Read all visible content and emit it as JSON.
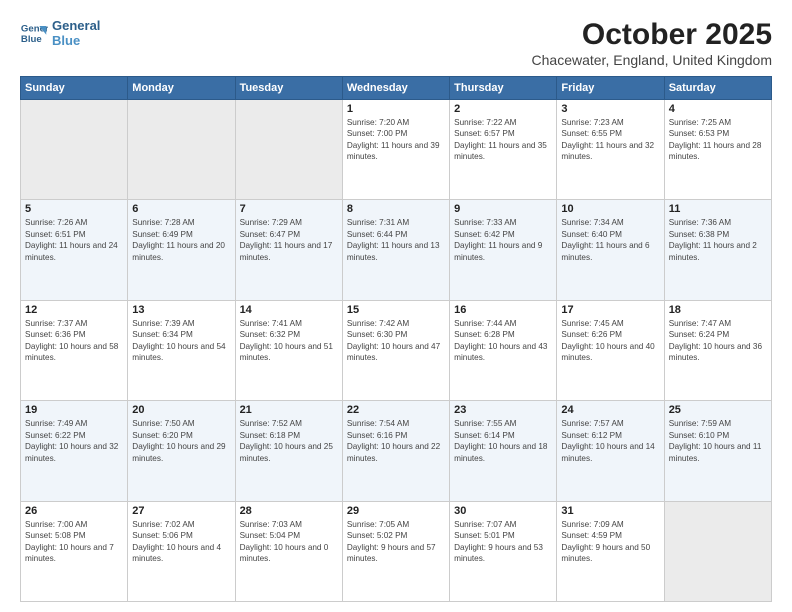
{
  "header": {
    "logo_line1": "General",
    "logo_line2": "Blue",
    "month": "October 2025",
    "location": "Chacewater, England, United Kingdom"
  },
  "weekdays": [
    "Sunday",
    "Monday",
    "Tuesday",
    "Wednesday",
    "Thursday",
    "Friday",
    "Saturday"
  ],
  "weeks": [
    [
      {
        "day": "",
        "empty": true
      },
      {
        "day": "",
        "empty": true
      },
      {
        "day": "",
        "empty": true
      },
      {
        "day": "1",
        "sunrise": "7:20 AM",
        "sunset": "7:00 PM",
        "daylight": "11 hours and 39 minutes."
      },
      {
        "day": "2",
        "sunrise": "7:22 AM",
        "sunset": "6:57 PM",
        "daylight": "11 hours and 35 minutes."
      },
      {
        "day": "3",
        "sunrise": "7:23 AM",
        "sunset": "6:55 PM",
        "daylight": "11 hours and 32 minutes."
      },
      {
        "day": "4",
        "sunrise": "7:25 AM",
        "sunset": "6:53 PM",
        "daylight": "11 hours and 28 minutes."
      }
    ],
    [
      {
        "day": "5",
        "sunrise": "7:26 AM",
        "sunset": "6:51 PM",
        "daylight": "11 hours and 24 minutes."
      },
      {
        "day": "6",
        "sunrise": "7:28 AM",
        "sunset": "6:49 PM",
        "daylight": "11 hours and 20 minutes."
      },
      {
        "day": "7",
        "sunrise": "7:29 AM",
        "sunset": "6:47 PM",
        "daylight": "11 hours and 17 minutes."
      },
      {
        "day": "8",
        "sunrise": "7:31 AM",
        "sunset": "6:44 PM",
        "daylight": "11 hours and 13 minutes."
      },
      {
        "day": "9",
        "sunrise": "7:33 AM",
        "sunset": "6:42 PM",
        "daylight": "11 hours and 9 minutes."
      },
      {
        "day": "10",
        "sunrise": "7:34 AM",
        "sunset": "6:40 PM",
        "daylight": "11 hours and 6 minutes."
      },
      {
        "day": "11",
        "sunrise": "7:36 AM",
        "sunset": "6:38 PM",
        "daylight": "11 hours and 2 minutes."
      }
    ],
    [
      {
        "day": "12",
        "sunrise": "7:37 AM",
        "sunset": "6:36 PM",
        "daylight": "10 hours and 58 minutes."
      },
      {
        "day": "13",
        "sunrise": "7:39 AM",
        "sunset": "6:34 PM",
        "daylight": "10 hours and 54 minutes."
      },
      {
        "day": "14",
        "sunrise": "7:41 AM",
        "sunset": "6:32 PM",
        "daylight": "10 hours and 51 minutes."
      },
      {
        "day": "15",
        "sunrise": "7:42 AM",
        "sunset": "6:30 PM",
        "daylight": "10 hours and 47 minutes."
      },
      {
        "day": "16",
        "sunrise": "7:44 AM",
        "sunset": "6:28 PM",
        "daylight": "10 hours and 43 minutes."
      },
      {
        "day": "17",
        "sunrise": "7:45 AM",
        "sunset": "6:26 PM",
        "daylight": "10 hours and 40 minutes."
      },
      {
        "day": "18",
        "sunrise": "7:47 AM",
        "sunset": "6:24 PM",
        "daylight": "10 hours and 36 minutes."
      }
    ],
    [
      {
        "day": "19",
        "sunrise": "7:49 AM",
        "sunset": "6:22 PM",
        "daylight": "10 hours and 32 minutes."
      },
      {
        "day": "20",
        "sunrise": "7:50 AM",
        "sunset": "6:20 PM",
        "daylight": "10 hours and 29 minutes."
      },
      {
        "day": "21",
        "sunrise": "7:52 AM",
        "sunset": "6:18 PM",
        "daylight": "10 hours and 25 minutes."
      },
      {
        "day": "22",
        "sunrise": "7:54 AM",
        "sunset": "6:16 PM",
        "daylight": "10 hours and 22 minutes."
      },
      {
        "day": "23",
        "sunrise": "7:55 AM",
        "sunset": "6:14 PM",
        "daylight": "10 hours and 18 minutes."
      },
      {
        "day": "24",
        "sunrise": "7:57 AM",
        "sunset": "6:12 PM",
        "daylight": "10 hours and 14 minutes."
      },
      {
        "day": "25",
        "sunrise": "7:59 AM",
        "sunset": "6:10 PM",
        "daylight": "10 hours and 11 minutes."
      }
    ],
    [
      {
        "day": "26",
        "sunrise": "7:00 AM",
        "sunset": "5:08 PM",
        "daylight": "10 hours and 7 minutes."
      },
      {
        "day": "27",
        "sunrise": "7:02 AM",
        "sunset": "5:06 PM",
        "daylight": "10 hours and 4 minutes."
      },
      {
        "day": "28",
        "sunrise": "7:03 AM",
        "sunset": "5:04 PM",
        "daylight": "10 hours and 0 minutes."
      },
      {
        "day": "29",
        "sunrise": "7:05 AM",
        "sunset": "5:02 PM",
        "daylight": "9 hours and 57 minutes."
      },
      {
        "day": "30",
        "sunrise": "7:07 AM",
        "sunset": "5:01 PM",
        "daylight": "9 hours and 53 minutes."
      },
      {
        "day": "31",
        "sunrise": "7:09 AM",
        "sunset": "4:59 PM",
        "daylight": "9 hours and 50 minutes."
      },
      {
        "day": "",
        "empty": true
      }
    ]
  ]
}
